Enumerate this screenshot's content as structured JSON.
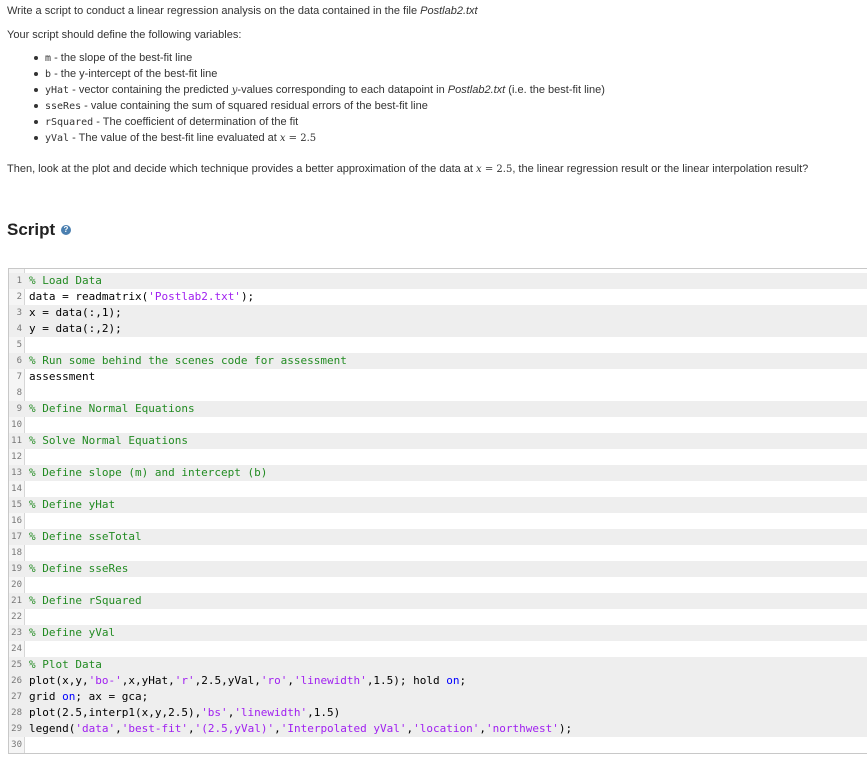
{
  "problem": {
    "intro_text": "Write a script to conduct a linear regression analysis on the data contained in the file ",
    "intro_file": "Postlab2.txt",
    "define_text": "Your script should define the following variables:",
    "variables": [
      {
        "name": "m",
        "desc_parts": [
          " - the slope of the best-fit line"
        ]
      },
      {
        "name": "b",
        "desc_parts": [
          " - the y-intercept of the best-fit line"
        ]
      },
      {
        "name": "yHat",
        "desc_a": " - vector containing the predicted ",
        "math": "y",
        "desc_b": "-values corresponding to each datapoint in ",
        "file": "Postlab2.txt",
        "desc_c": " (i.e. the best-fit line)"
      },
      {
        "name": "sseRes",
        "desc_parts": [
          " - value containing the sum of squared residual errors of the best-fit line"
        ]
      },
      {
        "name": "rSquared",
        "desc_parts": [
          " - The coefficient of determination of the fit"
        ]
      },
      {
        "name": "yVal",
        "desc_a": " - The value of the best-fit line evaluated at ",
        "math": "x",
        "eq": " = 2.5"
      }
    ],
    "then_a": "Then, look at the plot and decide which technique provides a better approximation of the data at ",
    "then_math": "x",
    "then_eq": " = 2.5",
    "then_b": ", the linear regression result or the linear interpolation result?"
  },
  "script_section": {
    "heading": "Script",
    "help_glyph": "?"
  },
  "code_lines": [
    {
      "n": "1",
      "grey": true,
      "tokens": [
        {
          "t": "% Load Data",
          "c": "com"
        }
      ]
    },
    {
      "n": "2",
      "grey": false,
      "tokens": [
        {
          "t": "data = readmatrix(",
          "c": "plain"
        },
        {
          "t": "'Postlab2.txt'",
          "c": "str"
        },
        {
          "t": ");",
          "c": "plain"
        }
      ]
    },
    {
      "n": "3",
      "grey": true,
      "tokens": [
        {
          "t": "x = data(:,1);",
          "c": "plain"
        }
      ]
    },
    {
      "n": "4",
      "grey": true,
      "tokens": [
        {
          "t": "y = data(:,2);",
          "c": "plain"
        }
      ]
    },
    {
      "n": "5",
      "grey": false,
      "tokens": []
    },
    {
      "n": "6",
      "grey": true,
      "tokens": [
        {
          "t": "% Run some behind the scenes code for assessment",
          "c": "com"
        }
      ]
    },
    {
      "n": "7",
      "grey": false,
      "tokens": [
        {
          "t": "assessment",
          "c": "plain"
        }
      ]
    },
    {
      "n": "8",
      "grey": false,
      "tokens": []
    },
    {
      "n": "9",
      "grey": true,
      "tokens": [
        {
          "t": "% Define Normal Equations",
          "c": "com"
        }
      ]
    },
    {
      "n": "10",
      "grey": false,
      "tokens": []
    },
    {
      "n": "11",
      "grey": true,
      "tokens": [
        {
          "t": "% Solve Normal Equations",
          "c": "com"
        }
      ]
    },
    {
      "n": "12",
      "grey": false,
      "tokens": []
    },
    {
      "n": "13",
      "grey": true,
      "tokens": [
        {
          "t": "% Define slope (m) and intercept (b)",
          "c": "com"
        }
      ]
    },
    {
      "n": "14",
      "grey": false,
      "tokens": []
    },
    {
      "n": "15",
      "grey": true,
      "tokens": [
        {
          "t": "% Define yHat",
          "c": "com"
        }
      ]
    },
    {
      "n": "16",
      "grey": false,
      "tokens": []
    },
    {
      "n": "17",
      "grey": true,
      "tokens": [
        {
          "t": "% Define sseTotal",
          "c": "com"
        }
      ]
    },
    {
      "n": "18",
      "grey": false,
      "tokens": []
    },
    {
      "n": "19",
      "grey": true,
      "tokens": [
        {
          "t": "% Define sseRes",
          "c": "com"
        }
      ]
    },
    {
      "n": "20",
      "grey": false,
      "tokens": []
    },
    {
      "n": "21",
      "grey": true,
      "tokens": [
        {
          "t": "% Define rSquared",
          "c": "com"
        }
      ]
    },
    {
      "n": "22",
      "grey": false,
      "tokens": []
    },
    {
      "n": "23",
      "grey": true,
      "tokens": [
        {
          "t": "% Define yVal",
          "c": "com"
        }
      ]
    },
    {
      "n": "24",
      "grey": false,
      "tokens": []
    },
    {
      "n": "25",
      "grey": true,
      "tokens": [
        {
          "t": "% Plot Data",
          "c": "com"
        }
      ]
    },
    {
      "n": "26",
      "grey": true,
      "tokens": [
        {
          "t": "plot(x,y,",
          "c": "plain"
        },
        {
          "t": "'bo-'",
          "c": "str"
        },
        {
          "t": ",x,yHat,",
          "c": "plain"
        },
        {
          "t": "'r'",
          "c": "str"
        },
        {
          "t": ",2.5,yVal,",
          "c": "plain"
        },
        {
          "t": "'ro'",
          "c": "str"
        },
        {
          "t": ",",
          "c": "plain"
        },
        {
          "t": "'linewidth'",
          "c": "str"
        },
        {
          "t": ",1.5); hold ",
          "c": "plain"
        },
        {
          "t": "on",
          "c": "kw"
        },
        {
          "t": ";",
          "c": "plain"
        }
      ]
    },
    {
      "n": "27",
      "grey": true,
      "tokens": [
        {
          "t": "grid ",
          "c": "plain"
        },
        {
          "t": "on",
          "c": "kw"
        },
        {
          "t": "; ax = gca;",
          "c": "plain"
        }
      ]
    },
    {
      "n": "28",
      "grey": true,
      "tokens": [
        {
          "t": "plot(2.5,interp1(x,y,2.5),",
          "c": "plain"
        },
        {
          "t": "'bs'",
          "c": "str"
        },
        {
          "t": ",",
          "c": "plain"
        },
        {
          "t": "'linewidth'",
          "c": "str"
        },
        {
          "t": ",1.5)",
          "c": "plain"
        }
      ]
    },
    {
      "n": "29",
      "grey": true,
      "tokens": [
        {
          "t": "legend(",
          "c": "plain"
        },
        {
          "t": "'data'",
          "c": "str"
        },
        {
          "t": ",",
          "c": "plain"
        },
        {
          "t": "'best-fit'",
          "c": "str"
        },
        {
          "t": ",",
          "c": "plain"
        },
        {
          "t": "'(2.5,yVal)'",
          "c": "str"
        },
        {
          "t": ",",
          "c": "plain"
        },
        {
          "t": "'Interpolated yVal'",
          "c": "str"
        },
        {
          "t": ",",
          "c": "plain"
        },
        {
          "t": "'location'",
          "c": "str"
        },
        {
          "t": ",",
          "c": "plain"
        },
        {
          "t": "'northwest'",
          "c": "str"
        },
        {
          "t": ");",
          "c": "plain"
        }
      ]
    },
    {
      "n": "30",
      "grey": false,
      "tokens": []
    }
  ]
}
